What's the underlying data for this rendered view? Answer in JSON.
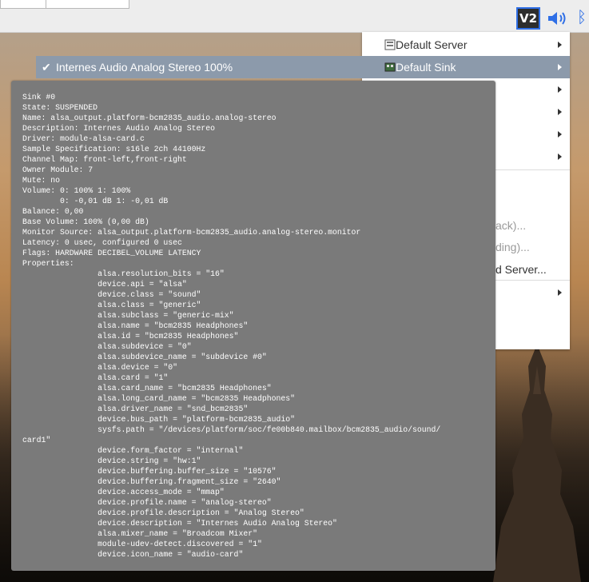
{
  "tray": {
    "vnc_label": "V2",
    "volume_icon": "speaker-volume-icon",
    "bluetooth_icon": "bluetooth-icon"
  },
  "menu": {
    "items": [
      {
        "label": "Default Server",
        "icon": "server-icon",
        "has_submenu": true
      },
      {
        "label": "Default Sink",
        "icon": "sink-card-icon",
        "has_submenu": true,
        "active": true
      }
    ],
    "partial_texts": [
      "ack)...",
      "ding)...",
      "d Server..."
    ]
  },
  "sink_submenu": {
    "selected_label": "Internes Audio Analog Stereo 100%",
    "checked": true
  },
  "tooltip": {
    "lines": [
      "Sink #0",
      "State: SUSPENDED",
      "Name: alsa_output.platform-bcm2835_audio.analog-stereo",
      "Description: Internes Audio Analog Stereo",
      "Driver: module-alsa-card.c",
      "Sample Specification: s16le 2ch 44100Hz",
      "Channel Map: front-left,front-right",
      "Owner Module: 7",
      "Mute: no",
      "Volume: 0: 100% 1: 100%",
      "        0: -0,01 dB 1: -0,01 dB",
      "Balance: 0,00",
      "Base Volume: 100% (0,00 dB)",
      "Monitor Source: alsa_output.platform-bcm2835_audio.analog-stereo.monitor",
      "Latency: 0 usec, configured 0 usec",
      "Flags: HARDWARE DECIBEL_VOLUME LATENCY",
      "Properties:",
      "                alsa.resolution_bits = \"16\"",
      "                device.api = \"alsa\"",
      "                device.class = \"sound\"",
      "                alsa.class = \"generic\"",
      "                alsa.subclass = \"generic-mix\"",
      "                alsa.name = \"bcm2835 Headphones\"",
      "                alsa.id = \"bcm2835 Headphones\"",
      "                alsa.subdevice = \"0\"",
      "                alsa.subdevice_name = \"subdevice #0\"",
      "                alsa.device = \"0\"",
      "                alsa.card = \"1\"",
      "                alsa.card_name = \"bcm2835 Headphones\"",
      "                alsa.long_card_name = \"bcm2835 Headphones\"",
      "                alsa.driver_name = \"snd_bcm2835\"",
      "                device.bus_path = \"platform-bcm2835_audio\"",
      "                sysfs.path = \"/devices/platform/soc/fe00b840.mailbox/bcm2835_audio/sound/",
      "card1\"",
      "                device.form_factor = \"internal\"",
      "                device.string = \"hw:1\"",
      "                device.buffering.buffer_size = \"10576\"",
      "                device.buffering.fragment_size = \"2640\"",
      "                device.access_mode = \"mmap\"",
      "                device.profile.name = \"analog-stereo\"",
      "                device.profile.description = \"Analog Stereo\"",
      "                device.description = \"Internes Audio Analog Stereo\"",
      "                alsa.mixer_name = \"Broadcom Mixer\"",
      "                module-udev-detect.discovered = \"1\"",
      "                device.icon_name = \"audio-card\""
    ]
  }
}
